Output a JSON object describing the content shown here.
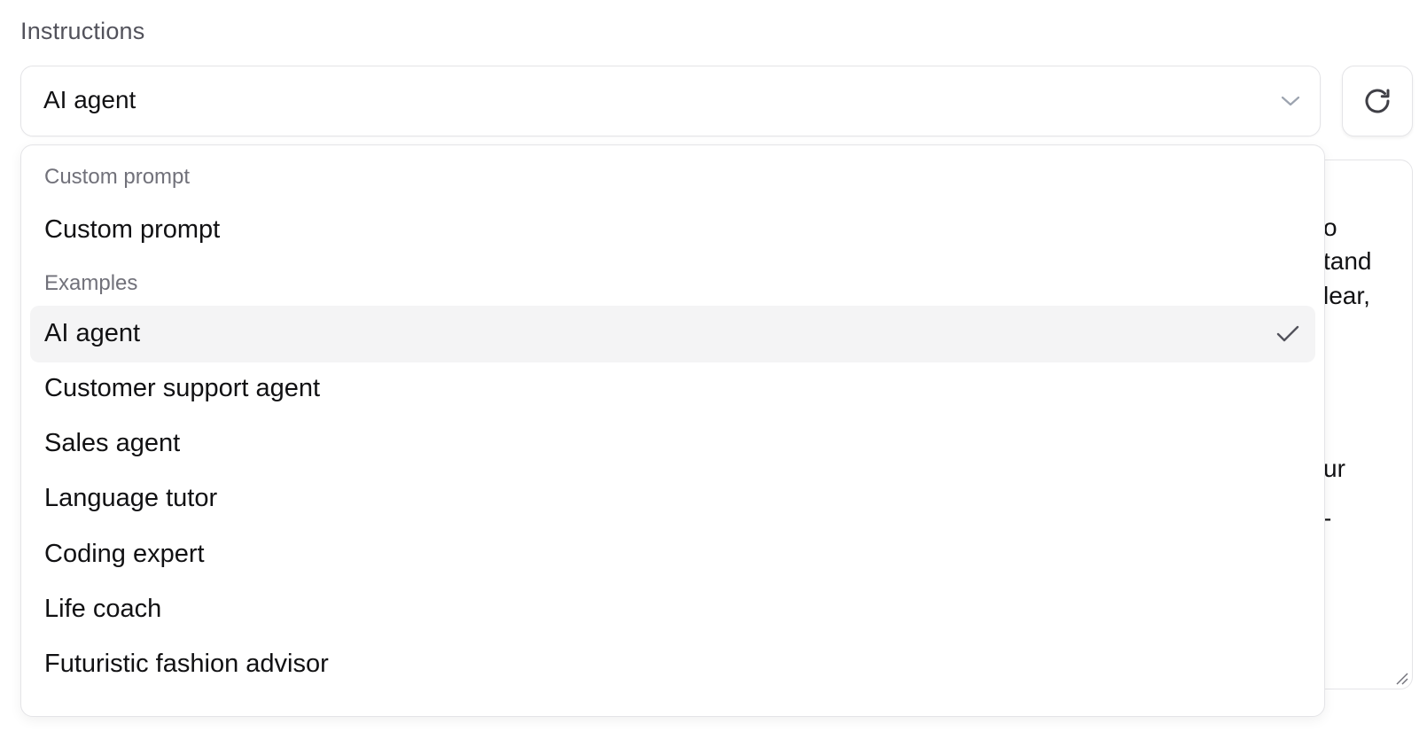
{
  "section": {
    "label": "Instructions"
  },
  "select": {
    "value": "AI agent"
  },
  "dropdown": {
    "groups": [
      {
        "label": "Custom prompt",
        "options": [
          {
            "label": "Custom prompt",
            "selected": false
          }
        ]
      },
      {
        "label": "Examples",
        "options": [
          {
            "label": "AI agent",
            "selected": true
          },
          {
            "label": "Customer support agent",
            "selected": false
          },
          {
            "label": "Sales agent",
            "selected": false
          },
          {
            "label": "Language tutor",
            "selected": false
          },
          {
            "label": "Coding expert",
            "selected": false
          },
          {
            "label": "Life coach",
            "selected": false
          },
          {
            "label": "Futuristic fashion advisor",
            "selected": false
          }
        ]
      }
    ]
  },
  "textarea": {
    "visible_fragments": [
      "o",
      "tand",
      "lear,",
      "ur",
      "-"
    ]
  },
  "icons": {
    "select_chevron": "chevron-down-icon",
    "reset": "refresh-icon",
    "selected_check": "check-icon",
    "resize": "resize-handle-icon"
  },
  "colors": {
    "border": "#e4e4e7",
    "selected_bg": "#f4f4f5",
    "muted_text": "#71717a",
    "label_text": "#52525b",
    "text": "#111113"
  }
}
